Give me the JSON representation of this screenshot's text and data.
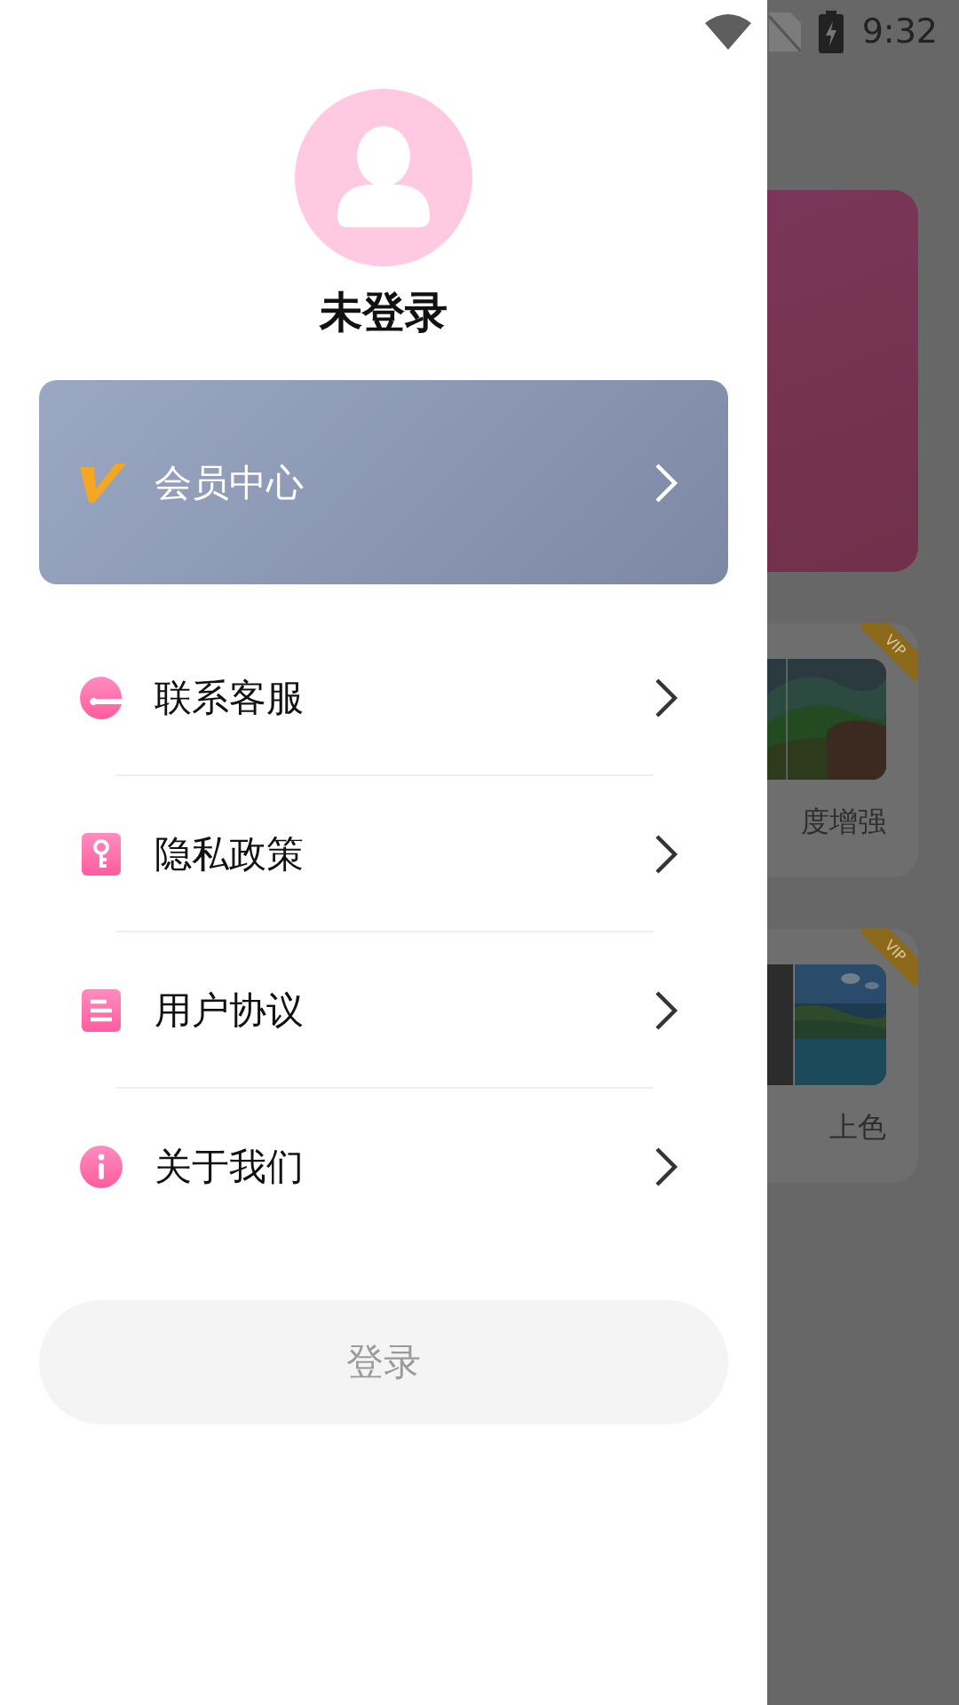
{
  "status_bar": {
    "time": "9:32"
  },
  "drawer": {
    "username": "未登录",
    "member_card": {
      "label": "会员中心"
    },
    "menu": [
      {
        "label": "联系客服",
        "kind": "service"
      },
      {
        "label": "隐私政策",
        "kind": "privacy"
      },
      {
        "label": "用户协议",
        "kind": "agreement"
      },
      {
        "label": "关于我们",
        "kind": "about"
      }
    ],
    "login_button": "登录"
  },
  "background": {
    "cards": [
      {
        "title": "度增强",
        "badge": "VIP",
        "kind": "mountain"
      },
      {
        "title": "上色",
        "badge": "VIP",
        "kind": "lake"
      }
    ]
  }
}
